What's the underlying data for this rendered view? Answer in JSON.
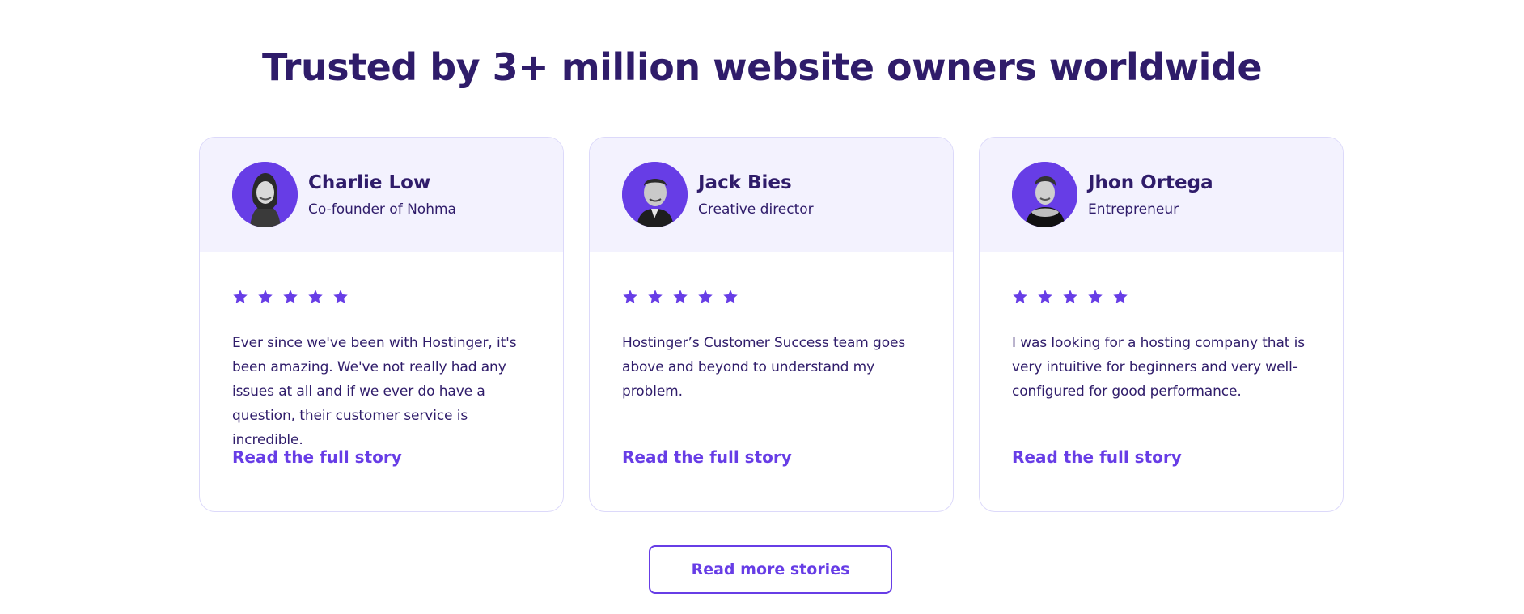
{
  "section": {
    "title": "Trusted by 3+ million website owners worldwide"
  },
  "accent_color": "#673de6",
  "text_color": "#2f1c6a",
  "testimonials": [
    {
      "name": "Charlie Low",
      "role": "Co-founder of Nohma",
      "rating": 5,
      "quote": "Ever since we've been with Hostinger, it's been amazing. We've not really had any issues at all and if we ever do have a question, their customer service is incredible.",
      "link_label": "Read the full story",
      "avatar_icon": "avatar-photo"
    },
    {
      "name": "Jack Bies",
      "role": "Creative director",
      "rating": 5,
      "quote": "Hostinger’s Customer Success team goes above and beyond to understand my problem.",
      "link_label": "Read the full story",
      "avatar_icon": "avatar-photo"
    },
    {
      "name": "Jhon Ortega",
      "role": "Entrepreneur",
      "rating": 5,
      "quote": "I was looking for a hosting company that is very intuitive for beginners and very well-configured for good performance.",
      "link_label": "Read the full story",
      "avatar_icon": "avatar-photo"
    }
  ],
  "footer": {
    "more_button_label": "Read more stories"
  }
}
